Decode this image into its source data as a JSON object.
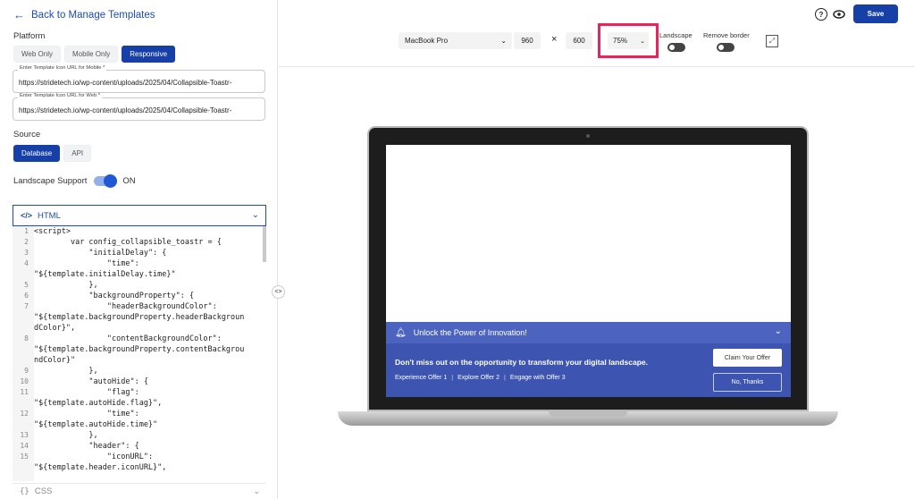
{
  "nav": {
    "back_label": "Back to Manage Templates"
  },
  "platform": {
    "label": "Platform",
    "options": [
      "Web Only",
      "Mobile Only",
      "Responsive"
    ],
    "selected": "Responsive"
  },
  "mobile_url": {
    "label": "Enter Template Icon URL for Mobile *",
    "value": "https://stridetech.io/wp-content/uploads/2025/04/Collapsible-Toastr-"
  },
  "web_url": {
    "label": "Enter Template Icon URL for Web *",
    "value": "https://stridetech.io/wp-content/uploads/2025/04/Collapsible-Toastr-"
  },
  "source": {
    "label": "Source",
    "options": [
      "Database",
      "API"
    ],
    "selected": "Database"
  },
  "landscape_support": {
    "label": "Landscape Support",
    "state": "ON"
  },
  "html_editor": {
    "tag": "</>",
    "title": "HTML",
    "lines": [
      {
        "n": "1",
        "t": "<script>"
      },
      {
        "n": "2",
        "t": "        var config_collapsible_toastr = {"
      },
      {
        "n": "3",
        "t": "            \"initialDelay\": {"
      },
      {
        "n": "4",
        "t": "                \"time\":"
      },
      {
        "n": "",
        "t": "\"${template.initialDelay.time}\""
      },
      {
        "n": "5",
        "t": "            },"
      },
      {
        "n": "6",
        "t": "            \"backgroundProperty\": {"
      },
      {
        "n": "7",
        "t": "                \"headerBackgroundColor\":"
      },
      {
        "n": "",
        "t": "\"${template.backgroundProperty.headerBackgroun"
      },
      {
        "n": "",
        "t": "dColor}\","
      },
      {
        "n": "8",
        "t": "                \"contentBackgroundColor\":"
      },
      {
        "n": "",
        "t": "\"${template.backgroundProperty.contentBackgrou"
      },
      {
        "n": "",
        "t": "ndColor}\""
      },
      {
        "n": "9",
        "t": "            },"
      },
      {
        "n": "10",
        "t": "            \"autoHide\": {"
      },
      {
        "n": "11",
        "t": "                \"flag\":"
      },
      {
        "n": "",
        "t": "\"${template.autoHide.flag}\","
      },
      {
        "n": "12",
        "t": "                \"time\":"
      },
      {
        "n": "",
        "t": "\"${template.autoHide.time}\""
      },
      {
        "n": "13",
        "t": "            },"
      },
      {
        "n": "14",
        "t": "            \"header\": {"
      },
      {
        "n": "15",
        "t": "                \"iconURL\":"
      },
      {
        "n": "",
        "t": "\"${template.header.iconURL}\","
      }
    ]
  },
  "css_editor": {
    "tag": "{}",
    "title": "CSS"
  },
  "preview": {
    "device": "MacBook Pro",
    "width": "960",
    "times": "×",
    "height": "600",
    "zoom": "75%",
    "landscape_label": "Landscape",
    "remove_border_label": "Remove border"
  },
  "actions": {
    "help": "?",
    "save_label": "Save"
  },
  "toast": {
    "header": "Unlock the Power of Innovation!",
    "message": "Don't miss out on the opportunity to transform your digital landscape.",
    "links": [
      "Experience Offer 1",
      "Explore Offer 2",
      "Engage with Offer 3"
    ],
    "claim_label": "Claim Your Offer",
    "dismiss_label": "No, Thanks"
  },
  "colors": {
    "primary": "#1640a8",
    "highlight": "#e8245c",
    "toast_bg": "#3d55b0",
    "toast_header": "#4c64bf"
  }
}
